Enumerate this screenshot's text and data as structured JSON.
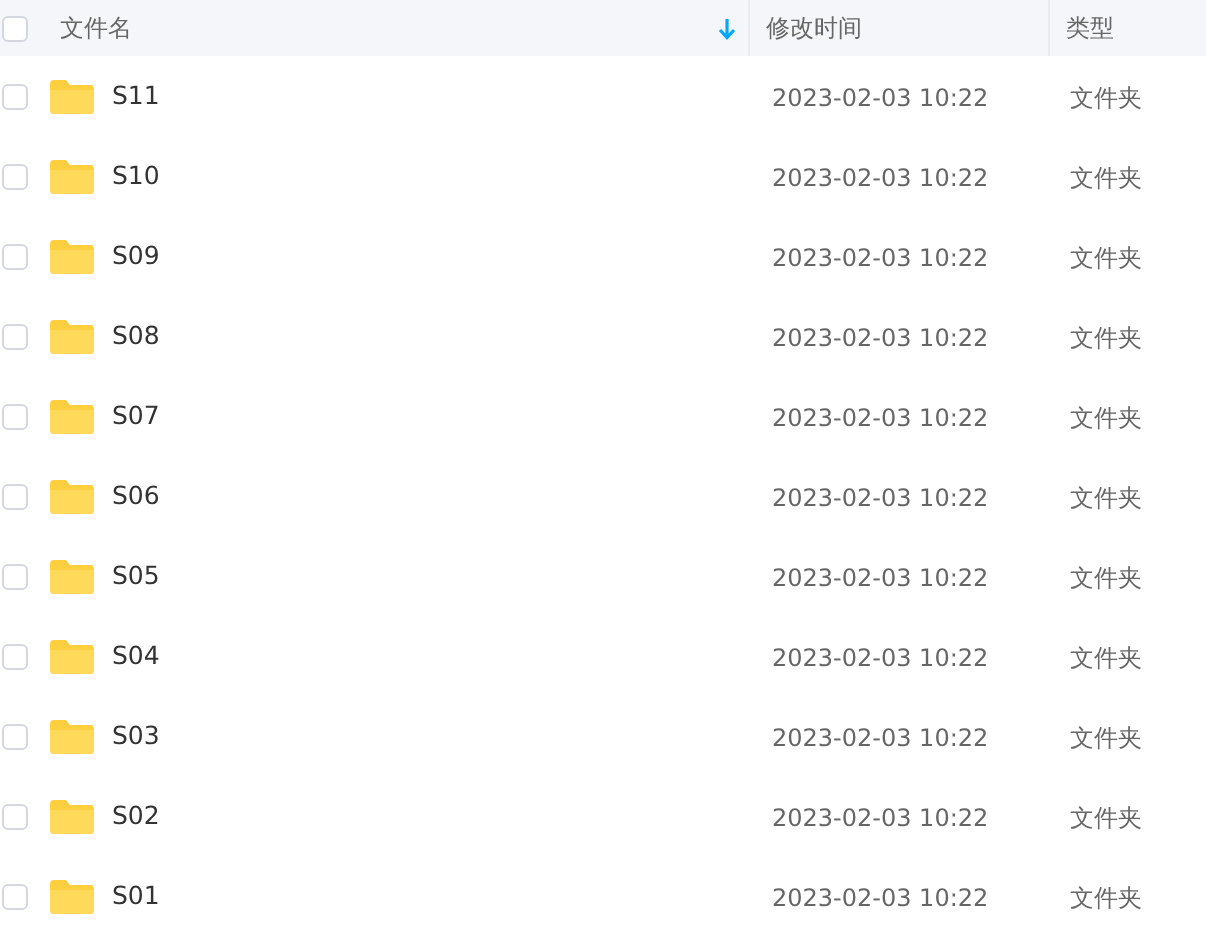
{
  "table": {
    "select_all": {
      "checked": false
    },
    "columns": [
      {
        "label": "文件名",
        "sorted": true
      },
      {
        "label": "修改时间",
        "sorted": false
      },
      {
        "label": "类型",
        "sorted": false
      }
    ],
    "rows": [
      {
        "name": "S11",
        "modified": "2023-02-03 10:22",
        "type": "文件夹",
        "checked": false
      },
      {
        "name": "S10",
        "modified": "2023-02-03 10:22",
        "type": "文件夹",
        "checked": false
      },
      {
        "name": "S09",
        "modified": "2023-02-03 10:22",
        "type": "文件夹",
        "checked": false
      },
      {
        "name": "S08",
        "modified": "2023-02-03 10:22",
        "type": "文件夹",
        "checked": false
      },
      {
        "name": "S07",
        "modified": "2023-02-03 10:22",
        "type": "文件夹",
        "checked": false
      },
      {
        "name": "S06",
        "modified": "2023-02-03 10:22",
        "type": "文件夹",
        "checked": false
      },
      {
        "name": "S05",
        "modified": "2023-02-03 10:22",
        "type": "文件夹",
        "checked": false
      },
      {
        "name": "S04",
        "modified": "2023-02-03 10:22",
        "type": "文件夹",
        "checked": false
      },
      {
        "name": "S03",
        "modified": "2023-02-03 10:22",
        "type": "文件夹",
        "checked": false
      },
      {
        "name": "S02",
        "modified": "2023-02-03 10:22",
        "type": "文件夹",
        "checked": false
      },
      {
        "name": "S01",
        "modified": "2023-02-03 10:22",
        "type": "文件夹",
        "checked": false
      }
    ]
  }
}
